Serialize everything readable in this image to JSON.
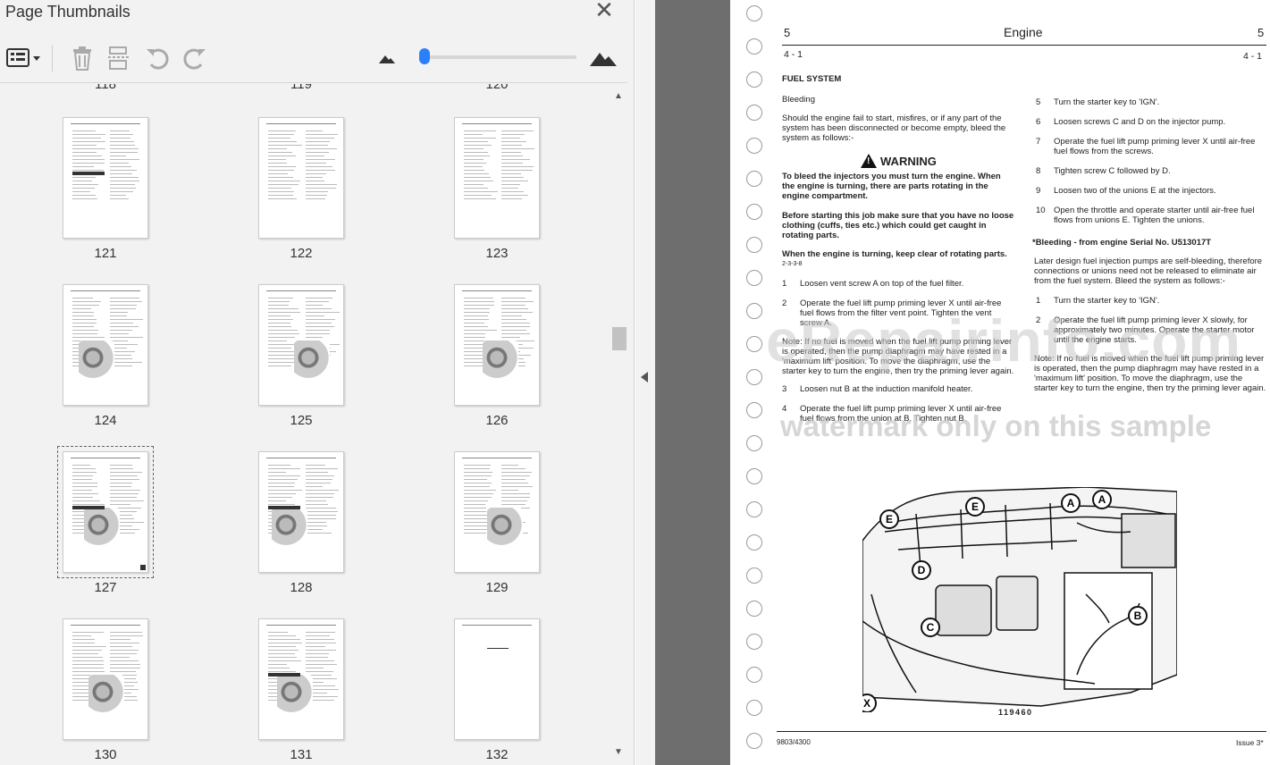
{
  "panel": {
    "title": "Page Thumbnails",
    "close_glyph": "✕",
    "toolbar": {
      "options_icon": "list-options-icon",
      "delete_icon": "trash-icon",
      "extract_icon": "extract-pages-icon",
      "rotate_left_icon": "rotate-ccw-icon",
      "rotate_right_icon": "rotate-cw-icon",
      "zoom_small_icon": "mountain-small-icon",
      "zoom_large_icon": "mountain-large-icon",
      "thumb_size_level": 0.0
    },
    "top_row_labels": [
      "118",
      "119",
      "120"
    ],
    "thumbnails": [
      {
        "label": "121"
      },
      {
        "label": "122"
      },
      {
        "label": "123"
      },
      {
        "label": "124"
      },
      {
        "label": "125"
      },
      {
        "label": "126"
      },
      {
        "label": "127",
        "selected": true
      },
      {
        "label": "128"
      },
      {
        "label": "129"
      },
      {
        "label": "130"
      },
      {
        "label": "131"
      },
      {
        "label": "132"
      }
    ]
  },
  "page": {
    "section_num_left": "5",
    "section_title": "Engine",
    "section_num_right": "5",
    "page_ref_left": "4 - 1",
    "page_ref_right": "4 - 1",
    "heading": "FUEL SYSTEM",
    "subheading": "Bleeding",
    "intro": [
      "Should the engine fail to start, misfires, or if any part of the",
      "system has been disconnected or become empty, bleed the",
      "system as follows:-"
    ],
    "warning_title": "WARNING",
    "warning_p1": [
      "To bleed the injectors you must turn the engine. When",
      "the engine is turning, there are parts rotating in the",
      "engine compartment."
    ],
    "warning_p2": [
      "Before starting this job make sure that you have no loose",
      "clothing (cuffs, ties etc.) which could get caught in",
      "rotating parts."
    ],
    "warning_p3": "When the engine is turning, keep clear of rotating parts.",
    "warning_code": "2-3-3-8",
    "left_steps": [
      {
        "n": "1",
        "lines": [
          "Loosen vent screw A on top of the fuel filter."
        ]
      },
      {
        "n": "2",
        "lines": [
          "Operate the fuel lift pump priming lever X until air-free",
          "fuel flows from the filter vent point. Tighten the vent",
          "screw A."
        ]
      }
    ],
    "note_left": [
      "Note: If no fuel is moved when the fuel lift pump priming lever",
      "is operated, then the pump diaphragm may have rested in a",
      "'maximum lift' position. To move the diaphragm, use the",
      "starter key to turn the engine, then try the priming lever again."
    ],
    "left_steps_2": [
      {
        "n": "3",
        "lines": [
          "Loosen nut B at the induction manifold heater."
        ]
      },
      {
        "n": "4",
        "lines": [
          "Operate the fuel lift pump priming lever X until air-free",
          "fuel flows from the union at B. Tighten nut B."
        ]
      }
    ],
    "right_steps": [
      {
        "n": "5",
        "lines": [
          "Turn the starter key to 'IGN'."
        ]
      },
      {
        "n": "6",
        "lines": [
          "Loosen screws C and D on the injector pump."
        ]
      },
      {
        "n": "7",
        "lines": [
          "Operate the fuel lift pump priming lever X until air-free",
          "fuel flows from the screws."
        ]
      },
      {
        "n": "8",
        "lines": [
          "Tighten screw C followed by D."
        ]
      },
      {
        "n": "9",
        "lines": [
          "Loosen two of the unions E at the injectors."
        ]
      },
      {
        "n": "10",
        "lines": [
          "Open the throttle and operate starter until air-free fuel",
          "flows from unions E. Tighten the unions."
        ]
      }
    ],
    "bleeding_serial": "*Bleeding - from engine Serial No. U513017T",
    "serial_intro": [
      "Later design fuel injection pumps are self-bleeding, therefore",
      "connections or unions need not be released to eliminate air",
      "from the fuel system. Bleed the system as follows:-"
    ],
    "right_steps_2": [
      {
        "n": "1",
        "lines": [
          "Turn the starter key to 'IGN'."
        ]
      },
      {
        "n": "2",
        "lines": [
          "Operate the fuel lift pump priming lever X slowly, for",
          "approximately two minutes. Operate the starter motor",
          "until the engine starts."
        ]
      }
    ],
    "note_right": [
      "Note: If no fuel is moved when the fuel lift pump priming lever",
      "is operated, then the pump diaphragm may have rested in a",
      "'maximum lift' position. To move the diaphragm, use the",
      "starter key to turn the engine, then try the priming lever again."
    ],
    "watermark_main": "eRepairinfo.com",
    "watermark_sub": "watermark only on this sample",
    "diagram_labels": [
      "A",
      "A",
      "E",
      "E",
      "D",
      "B",
      "C",
      "X"
    ],
    "diagram_code": "119460",
    "footer_left": "9803/4300",
    "footer_right": "Issue 3*"
  }
}
